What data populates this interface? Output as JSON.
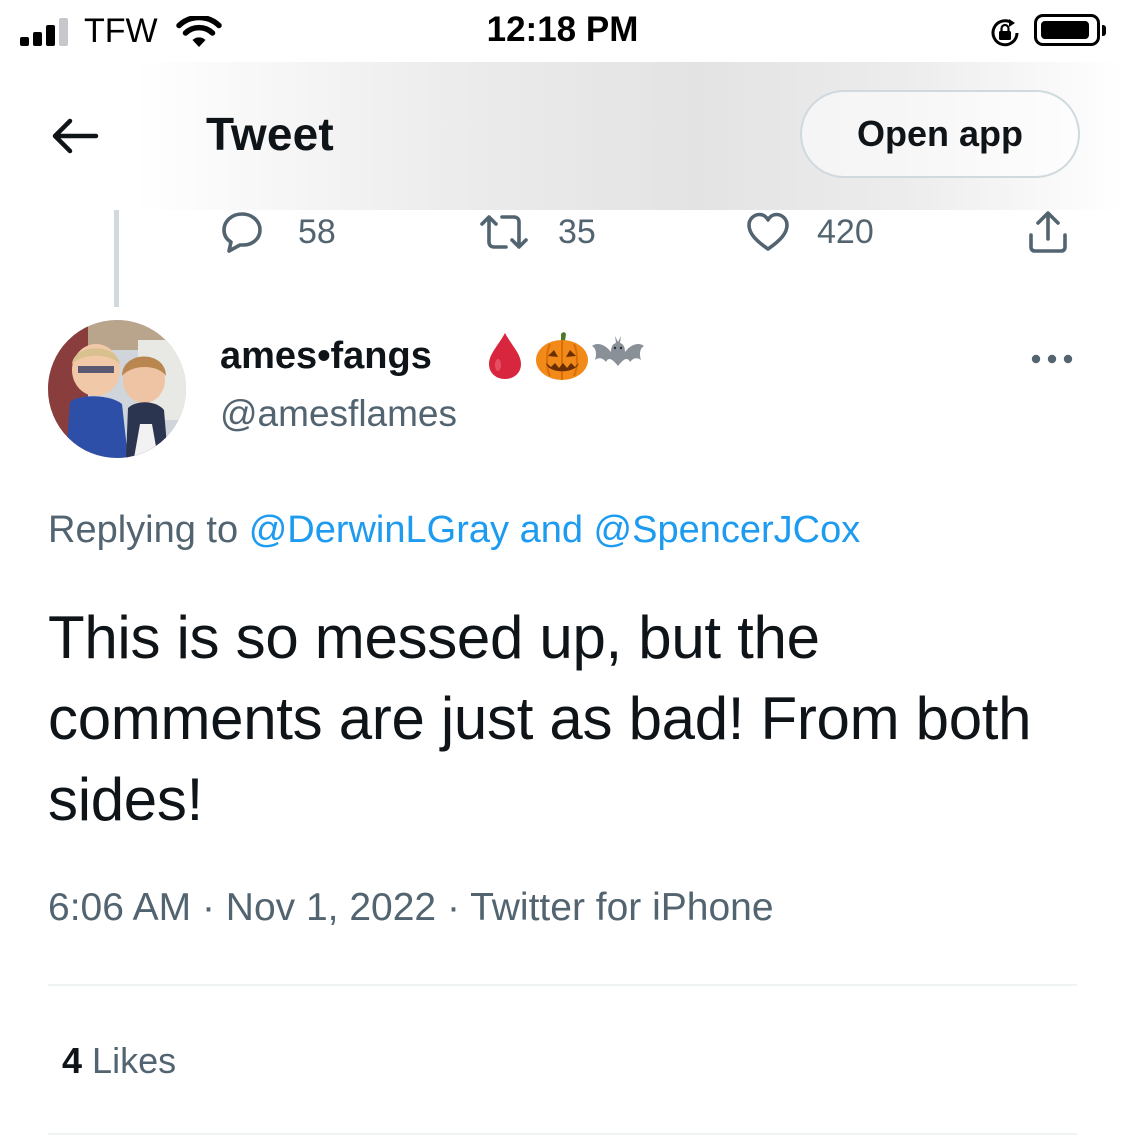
{
  "status_bar": {
    "carrier": "TFW",
    "time": "12:18 PM"
  },
  "header": {
    "title": "Tweet",
    "open_app_label": "Open app"
  },
  "parent_actions": {
    "replies": "58",
    "retweets": "35",
    "likes": "420"
  },
  "tweet": {
    "display_name": "ames•fangs",
    "name_emojis": [
      "drop-of-blood",
      "jack-o-lantern",
      "bat"
    ],
    "handle": "@amesflames",
    "replying_prefix": "Replying to",
    "mention_1": "@DerwinLGray",
    "mention_joiner": "and",
    "mention_2": "@SpencerJCox",
    "text": "This is so messed up, but the comments are just as bad! From both sides!",
    "time": "6:06 AM",
    "separator": "·",
    "date": "Nov 1, 2022",
    "source": "Twitter for iPhone",
    "likes_count": "4",
    "likes_label": "Likes"
  },
  "colors": {
    "text_primary": "#0f1419",
    "text_secondary": "#536471",
    "accent": "#1d9bf0",
    "blood_red": "#d7263d",
    "pumpkin": "#f28a1a"
  },
  "icons": {
    "back": "arrow-left-icon",
    "reply": "speech-bubble-icon",
    "retweet": "retweet-icon",
    "like": "heart-icon",
    "share": "share-icon",
    "more": "more-dots-icon"
  }
}
